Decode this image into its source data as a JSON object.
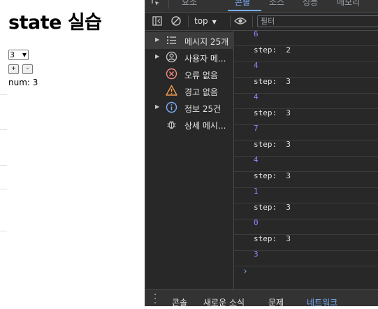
{
  "page": {
    "title": "state 실습",
    "select_value": "3",
    "plus_label": "+",
    "minus_label": "-",
    "num_text": "num: 3"
  },
  "devtools": {
    "tabs": [
      "요소",
      "콘솔",
      "소스",
      "성능",
      "메모리"
    ],
    "active_tab": "콘솔",
    "context": "top",
    "filter_placeholder": "필터",
    "sidebar": [
      {
        "label": "메시지 25개",
        "icon": "list-icon",
        "expandable": true
      },
      {
        "label": "사용자 메...",
        "icon": "user-icon",
        "expandable": true
      },
      {
        "label": "오류 없음",
        "icon": "error-icon",
        "expandable": false
      },
      {
        "label": "경고 없음",
        "icon": "warning-icon",
        "expandable": false
      },
      {
        "label": "정보 25건",
        "icon": "info-icon",
        "expandable": true
      },
      {
        "label": "상세 메시...",
        "icon": "bug-icon",
        "expandable": false
      }
    ],
    "console_lines": [
      {
        "text": "6",
        "kind": "num"
      },
      {
        "text": "step:  2",
        "kind": "str"
      },
      {
        "text": "4",
        "kind": "num"
      },
      {
        "text": "step:  3",
        "kind": "str"
      },
      {
        "text": "4",
        "kind": "num"
      },
      {
        "text": "step:  3",
        "kind": "str"
      },
      {
        "text": "7",
        "kind": "num"
      },
      {
        "text": "step:  3",
        "kind": "str"
      },
      {
        "text": "4",
        "kind": "num"
      },
      {
        "text": "step:  3",
        "kind": "str"
      },
      {
        "text": "1",
        "kind": "num"
      },
      {
        "text": "step:  3",
        "kind": "str"
      },
      {
        "text": "0",
        "kind": "num"
      },
      {
        "text": "step:  3",
        "kind": "str"
      },
      {
        "text": "3",
        "kind": "num"
      }
    ],
    "prompt": "›",
    "drawer_tabs": [
      "콘솔",
      "새로운 소식",
      "문제",
      "네트워크"
    ],
    "drawer_active": "네트워크"
  },
  "colors": {
    "accent": "#7cacf8",
    "number": "#9980ff",
    "error": "#f28b82",
    "warning": "#fdd663"
  }
}
